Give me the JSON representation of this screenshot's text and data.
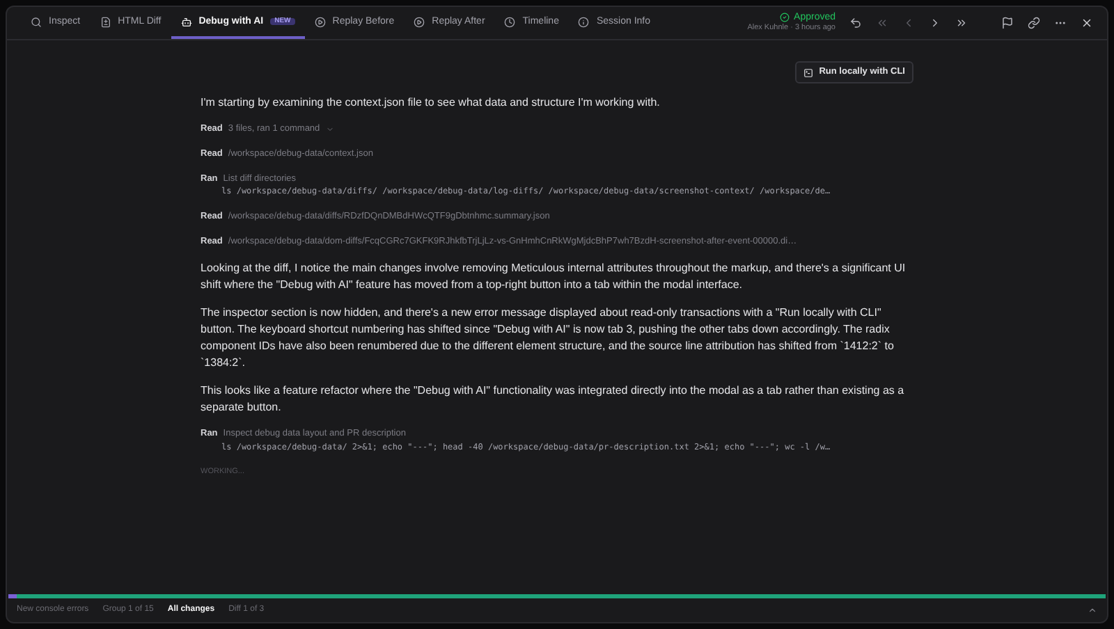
{
  "tabs": [
    {
      "label": "Inspect",
      "selected": false
    },
    {
      "label": "HTML Diff",
      "selected": false
    },
    {
      "label": "Debug with AI",
      "badge": "NEW",
      "selected": true
    },
    {
      "label": "Replay Before",
      "selected": false
    },
    {
      "label": "Replay After",
      "selected": false
    },
    {
      "label": "Timeline",
      "selected": false
    },
    {
      "label": "Session Info",
      "selected": false
    }
  ],
  "status": {
    "label": "Approved",
    "byline": "Alex Kuhnle · 3 hours ago"
  },
  "run_button": "Run locally with CLI",
  "messages": [
    {
      "kind": "paragraph",
      "text": "I'm starting by examining the context.json file to see what data and structure I'm working with."
    },
    {
      "kind": "tool",
      "verb": "Read",
      "text": "3 files, ran 1 command",
      "expanded": false
    },
    {
      "kind": "tool",
      "verb": "Read",
      "text": "/workspace/debug-data/context.json"
    },
    {
      "kind": "tool",
      "verb": "Ran",
      "text": "List diff directories",
      "command": "ls /workspace/debug-data/diffs/ /workspace/debug-data/log-diffs/ /workspace/debug-data/screenshot-context/ /workspace/de…"
    },
    {
      "kind": "tool",
      "verb": "Read",
      "text": "/workspace/debug-data/diffs/RDzfDQnDMBdHWcQTF9gDbtnhmc.summary.json"
    },
    {
      "kind": "tool",
      "verb": "Read",
      "text": "/workspace/debug-data/dom-diffs/FcqCGRc7GKFK9RJhkfbTrjLjLz-vs-GnHmhCnRkWgMjdcBhP7wh7BzdH-screenshot-after-event-00000.di…"
    },
    {
      "kind": "paragraph",
      "text": "Looking at the diff, I notice the main changes involve removing Meticulous internal attributes throughout the markup, and there's a significant UI shift where the \"Debug with AI\" feature has moved from a top-right button into a tab within the modal interface."
    },
    {
      "kind": "paragraph",
      "text": "The inspector section is now hidden, and there's a new error message displayed about read-only transactions with a \"Run locally with CLI\" button. The keyboard shortcut numbering has shifted since \"Debug with AI\" is now tab 3, pushing the other tabs down accordingly. The radix component IDs have also been renumbered due to the different element structure, and the source line attribution has shifted from `1412:2` to `1384:2`."
    },
    {
      "kind": "paragraph",
      "text": "This looks like a feature refactor where the \"Debug with AI\" functionality was integrated directly into the modal as a tab rather than existing as a separate button."
    },
    {
      "kind": "tool",
      "verb": "Ran",
      "text": "Inspect debug data layout and PR description",
      "command": "ls /workspace/debug-data/ 2>&1; echo \"---\"; head -40 /workspace/debug-data/pr-description.txt 2>&1; echo \"---\"; wc -l /w…"
    },
    {
      "kind": "status",
      "text": "WORKING..."
    }
  ],
  "progress": {
    "level": 0.008
  },
  "footer": [
    {
      "label": "New console errors",
      "selected": false
    },
    {
      "label": "Group 1 of 15",
      "selected": false
    },
    {
      "label": "All changes",
      "selected": true
    },
    {
      "label": "Diff 1 of 3",
      "selected": false
    }
  ]
}
